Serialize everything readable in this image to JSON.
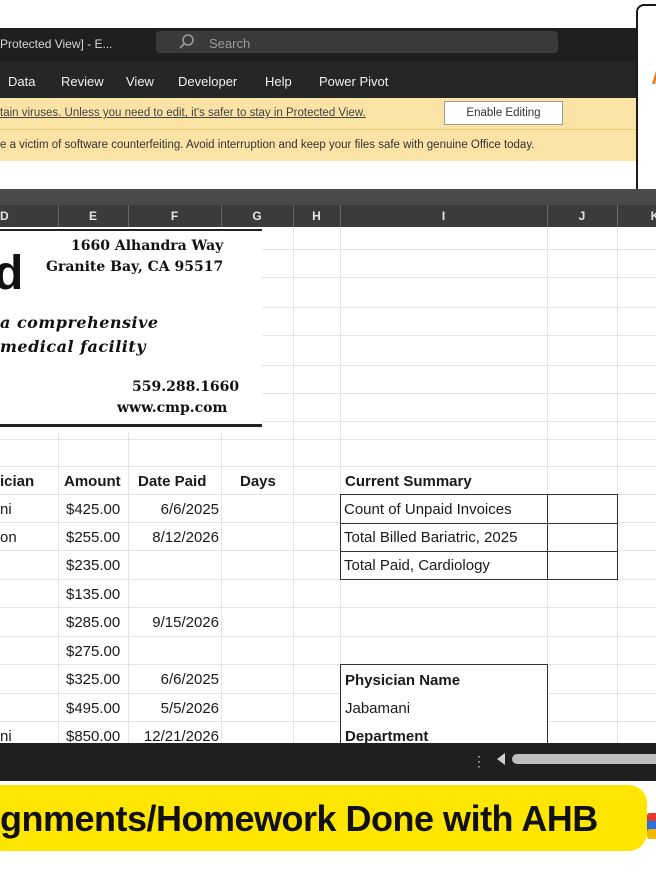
{
  "window": {
    "title": "Protected View] - E...",
    "search_placeholder": "Search"
  },
  "ribbon": {
    "tabs": [
      "Data",
      "Review",
      "View",
      "Developer",
      "Help",
      "Power Pivot"
    ]
  },
  "protected_view_bar": {
    "message": "tain viruses. Unless you need to edit, it's safer to stay in Protected View.",
    "button_label": "Enable Editing"
  },
  "license_bar": {
    "message": "e a victim of software counterfeiting. Avoid interruption and keep your files safe with genuine Office today."
  },
  "columns": [
    "D",
    "E",
    "F",
    "G",
    "H",
    "I",
    "J",
    "K"
  ],
  "letterhead": {
    "logo_letter": "d",
    "address_line1": "1660 Alhandra Way",
    "address_line2": "Granite Bay, CA 95517",
    "tagline_line1": "a comprehensive",
    "tagline_line2": "medical facility",
    "phone": "559.288.1660",
    "website": "www.cmp.com"
  },
  "table": {
    "headers": {
      "physician": "ician",
      "amount": "Amount",
      "date_paid": "Date Paid",
      "days": "Days"
    },
    "rows": [
      {
        "physician": "ni",
        "amount": "$425.00",
        "date_paid": "6/6/2025"
      },
      {
        "physician": "on",
        "amount": "$255.00",
        "date_paid": "8/12/2026"
      },
      {
        "physician": "",
        "amount": "$235.00",
        "date_paid": ""
      },
      {
        "physician": "",
        "amount": "$135.00",
        "date_paid": ""
      },
      {
        "physician": "",
        "amount": "$285.00",
        "date_paid": "9/15/2026"
      },
      {
        "physician": "",
        "amount": "$275.00",
        "date_paid": ""
      },
      {
        "physician": "",
        "amount": "$325.00",
        "date_paid": "6/6/2025"
      },
      {
        "physician": "",
        "amount": "$495.00",
        "date_paid": "5/5/2026"
      },
      {
        "physician": "ni",
        "amount": "$850.00",
        "date_paid": "12/21/2026"
      }
    ]
  },
  "summary": {
    "title": "Current Summary",
    "items": [
      "Count of Unpaid Invoices",
      "Total Billed Bariatric, 2025",
      "Total Paid, Cardiology"
    ]
  },
  "lookup": {
    "label1": "Physician Name",
    "value1": "Jabamani",
    "label2": "Department"
  },
  "banner": {
    "text": "gnments/Homework Done with AHB"
  },
  "colors": {
    "warning_bar": "#fbe3a5",
    "banner": "#ffe600",
    "title_bar": "#1f1f1f"
  }
}
